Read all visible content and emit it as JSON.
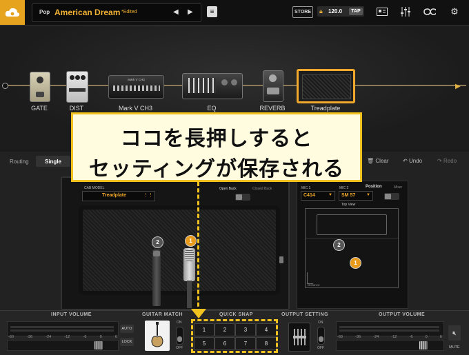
{
  "topbar": {
    "genre": "Pop",
    "preset_name": "American Dream",
    "edited": "*Edited",
    "prev_label": "◀",
    "next_label": "▶",
    "store_label": "STORE",
    "tempo": "120.0",
    "tap_label": "TAP"
  },
  "chain": {
    "items": [
      {
        "label": "GATE"
      },
      {
        "label": "DIST"
      },
      {
        "label": "Mark V CH3"
      },
      {
        "label": "EQ"
      },
      {
        "label": "REVERB"
      },
      {
        "label": "Treadplate"
      }
    ],
    "amp_faceplate": "Mark V CH3"
  },
  "callout": {
    "line1": "ココを長押しすると",
    "line2": "セッティングが保存される"
  },
  "routing": {
    "label": "Routing",
    "mode": "Single",
    "clear_label": "Clear",
    "undo_label": "Undo",
    "redo_label": "Redo"
  },
  "cab": {
    "model_label": "CAB MODEL",
    "model_value": "Treadplate",
    "open_back": "Open Back",
    "closed_back": "Closed Back",
    "mic1_label": "MIC 1",
    "mic1_value": "C414",
    "mic2_label": "MIC 2",
    "mic2_value": "SM 57",
    "position_label": "Position",
    "mixer_label": "Mixer",
    "top_view": "Top View",
    "distance": "Distance",
    "marker1": "1",
    "marker2": "2"
  },
  "bottom": {
    "input_volume": "INPUT VOLUME",
    "guitar_match": "GUITAR MATCH",
    "quick_snap": "QUICK SNAP",
    "output_setting": "OUTPUT SETTING",
    "output_volume": "OUTPUT VOLUME",
    "auto_label": "AUTO",
    "lock_label": "LOCK",
    "on_label": "ON",
    "off_label": "OFF",
    "mute_label": "MUTE",
    "scale": [
      "-60",
      "-36",
      "-24",
      "-12",
      "-6",
      "0",
      "6"
    ],
    "snaps": [
      "1",
      "2",
      "3",
      "4",
      "5",
      "6",
      "7",
      "8"
    ]
  }
}
